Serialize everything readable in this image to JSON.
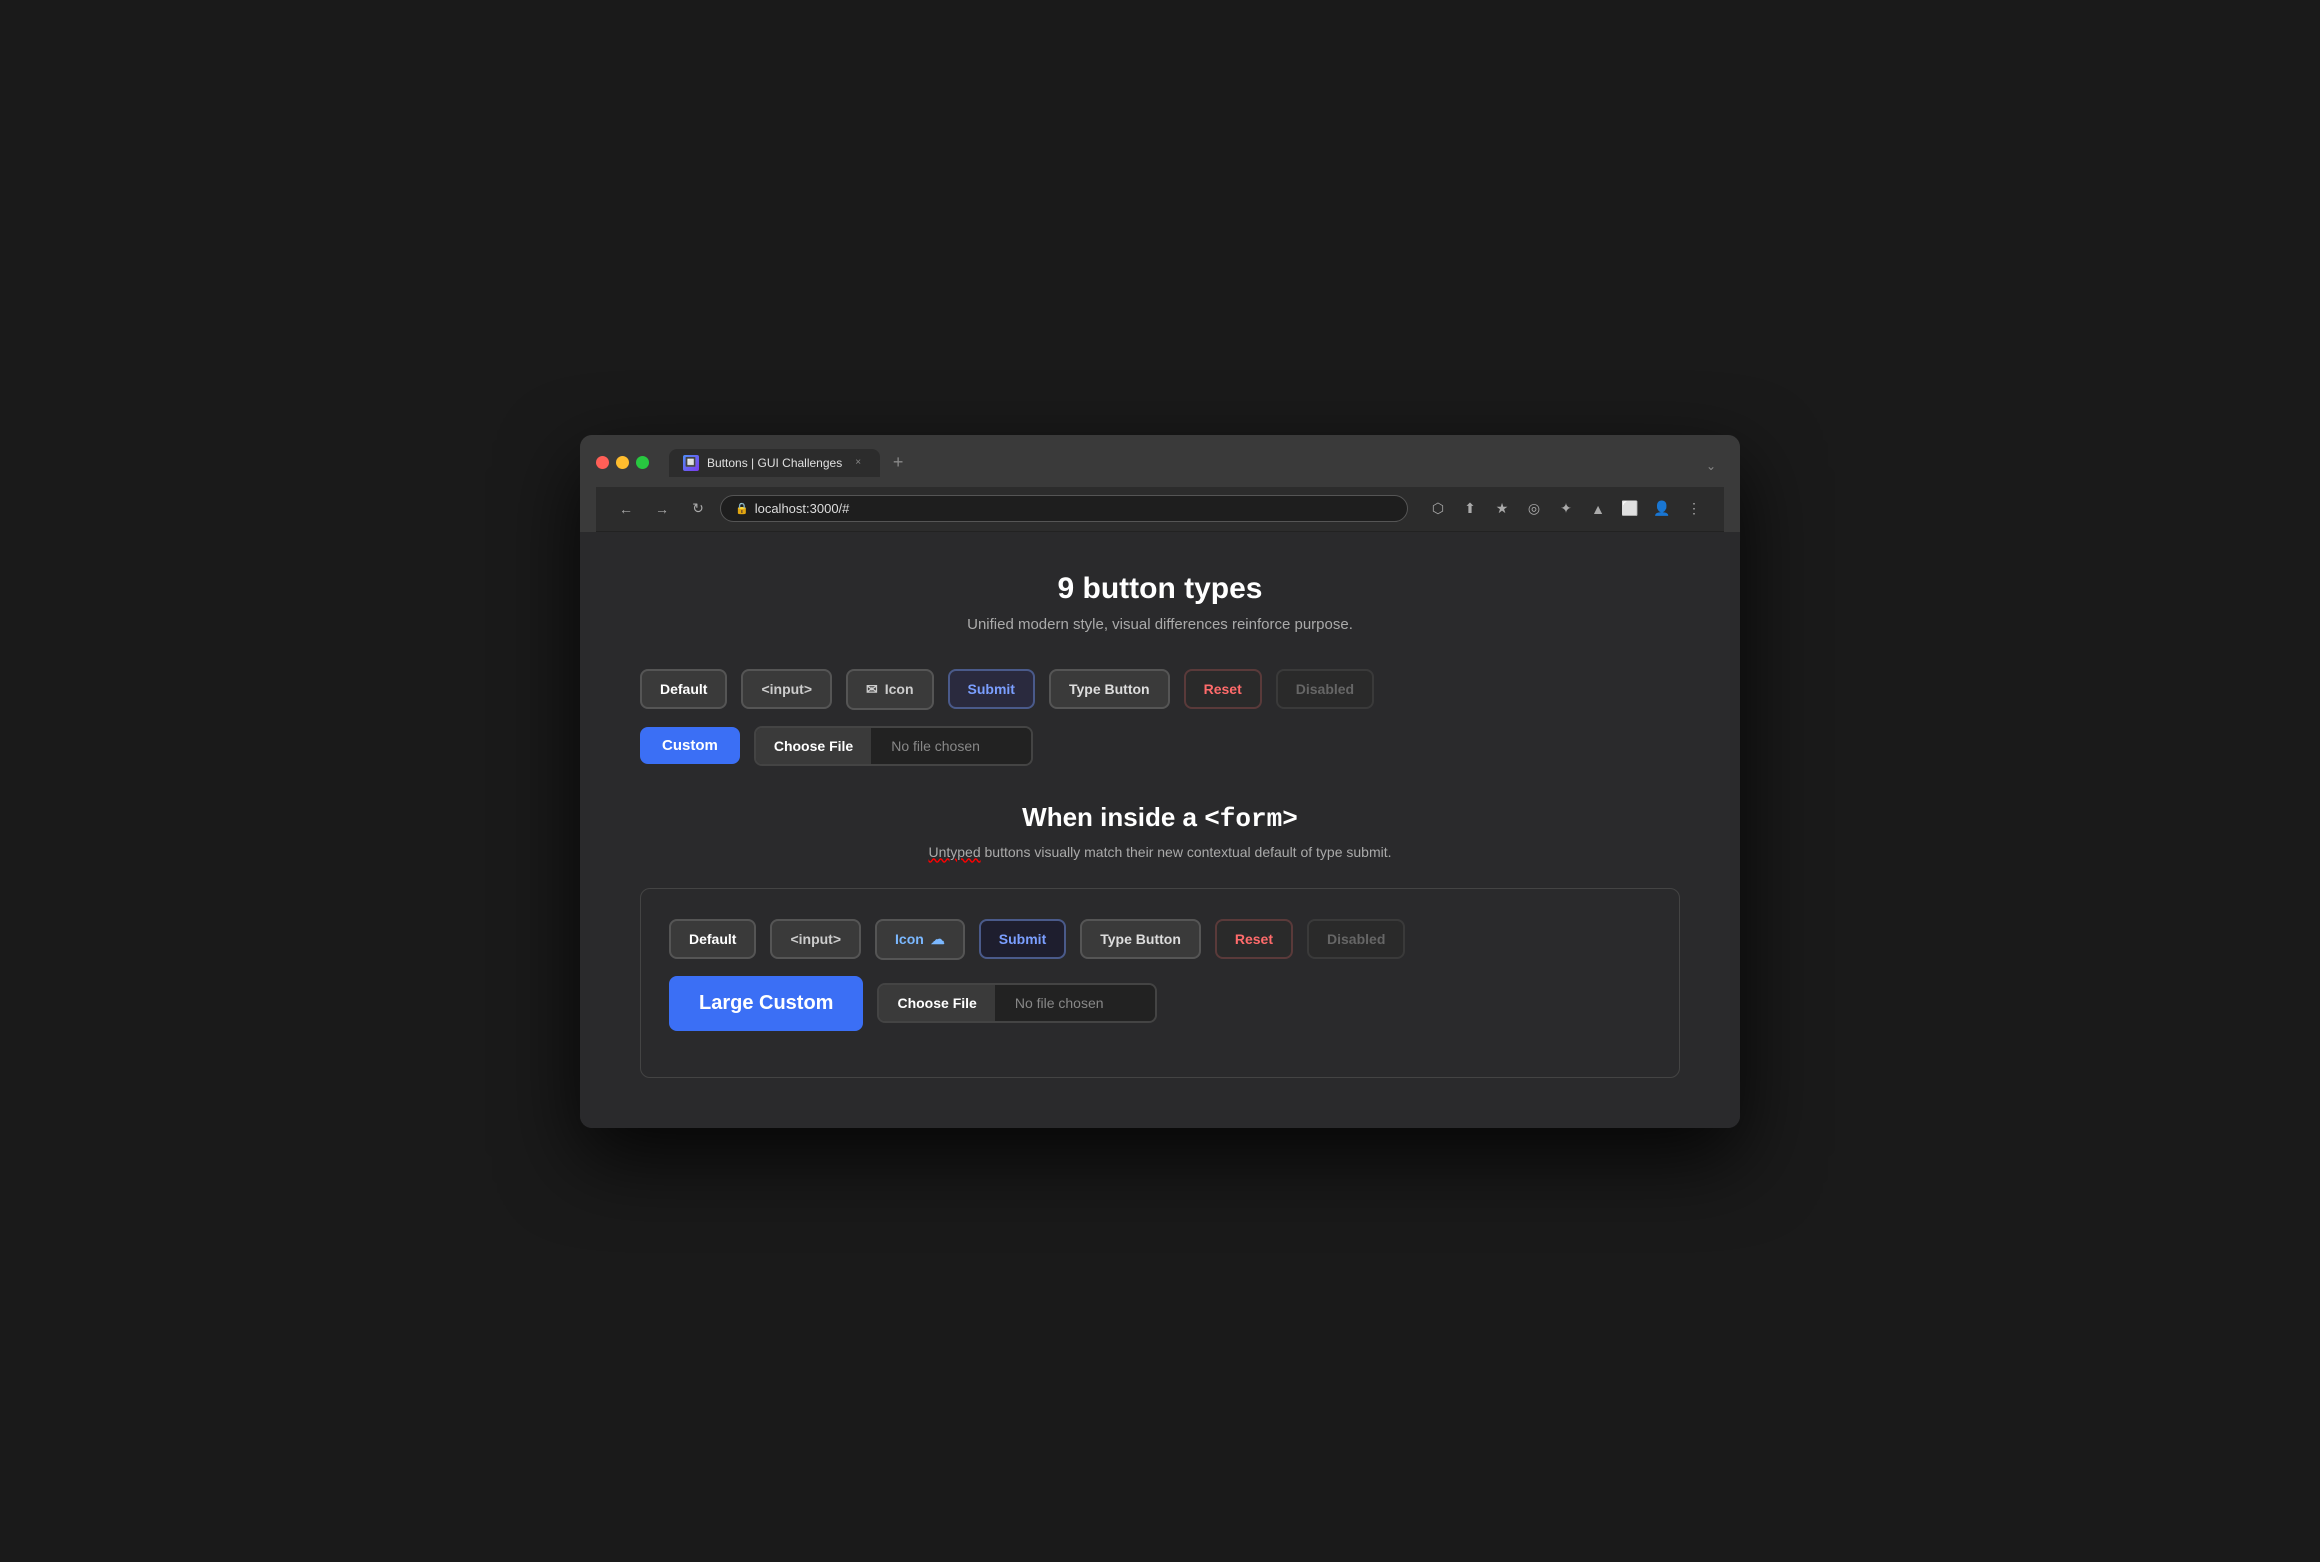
{
  "browser": {
    "tab_title": "Buttons | GUI Challenges",
    "tab_favicon": "🔲",
    "url": "localhost:3000/#",
    "close_label": "×",
    "add_tab_label": "+",
    "more_label": "⌄"
  },
  "nav": {
    "back": "←",
    "forward": "→",
    "reload": "↻",
    "lock_icon": "🔒"
  },
  "toolbar": {
    "icons": [
      "⬡",
      "⬆",
      "★",
      "◎",
      "✦",
      "▲",
      "⬜",
      "👤",
      "⋮"
    ]
  },
  "page": {
    "title": "9 button types",
    "subtitle": "Unified modern style, visual differences reinforce purpose.",
    "buttons_row1": [
      {
        "label": "Default",
        "type": "default"
      },
      {
        "label": "<input>",
        "type": "input"
      },
      {
        "label": "Icon",
        "type": "icon",
        "icon": "✉"
      },
      {
        "label": "Submit",
        "type": "submit"
      },
      {
        "label": "Type Button",
        "type": "type-button"
      },
      {
        "label": "Reset",
        "type": "reset"
      },
      {
        "label": "Disabled",
        "type": "disabled"
      }
    ],
    "buttons_row2": [
      {
        "label": "Custom",
        "type": "custom"
      },
      {
        "choose_file": "Choose File",
        "no_file": "No file chosen"
      }
    ],
    "form_section": {
      "title_prefix": "When inside a ",
      "title_code": "<form>",
      "subtitle_plain": "buttons visually match their new contextual default of type submit.",
      "subtitle_underlined": "Untyped",
      "buttons_row1": [
        {
          "label": "Default",
          "type": "default"
        },
        {
          "label": "<input>",
          "type": "input"
        },
        {
          "label": "Icon",
          "type": "icon-cloud",
          "icon": "☁"
        },
        {
          "label": "Submit",
          "type": "submit"
        },
        {
          "label": "Type Button",
          "type": "type-button"
        },
        {
          "label": "Reset",
          "type": "reset"
        },
        {
          "label": "Disabled",
          "type": "disabled"
        }
      ],
      "buttons_row2": [
        {
          "label": "Large Custom",
          "type": "custom-large"
        },
        {
          "choose_file": "Choose File",
          "no_file": "No file chosen"
        }
      ]
    }
  }
}
